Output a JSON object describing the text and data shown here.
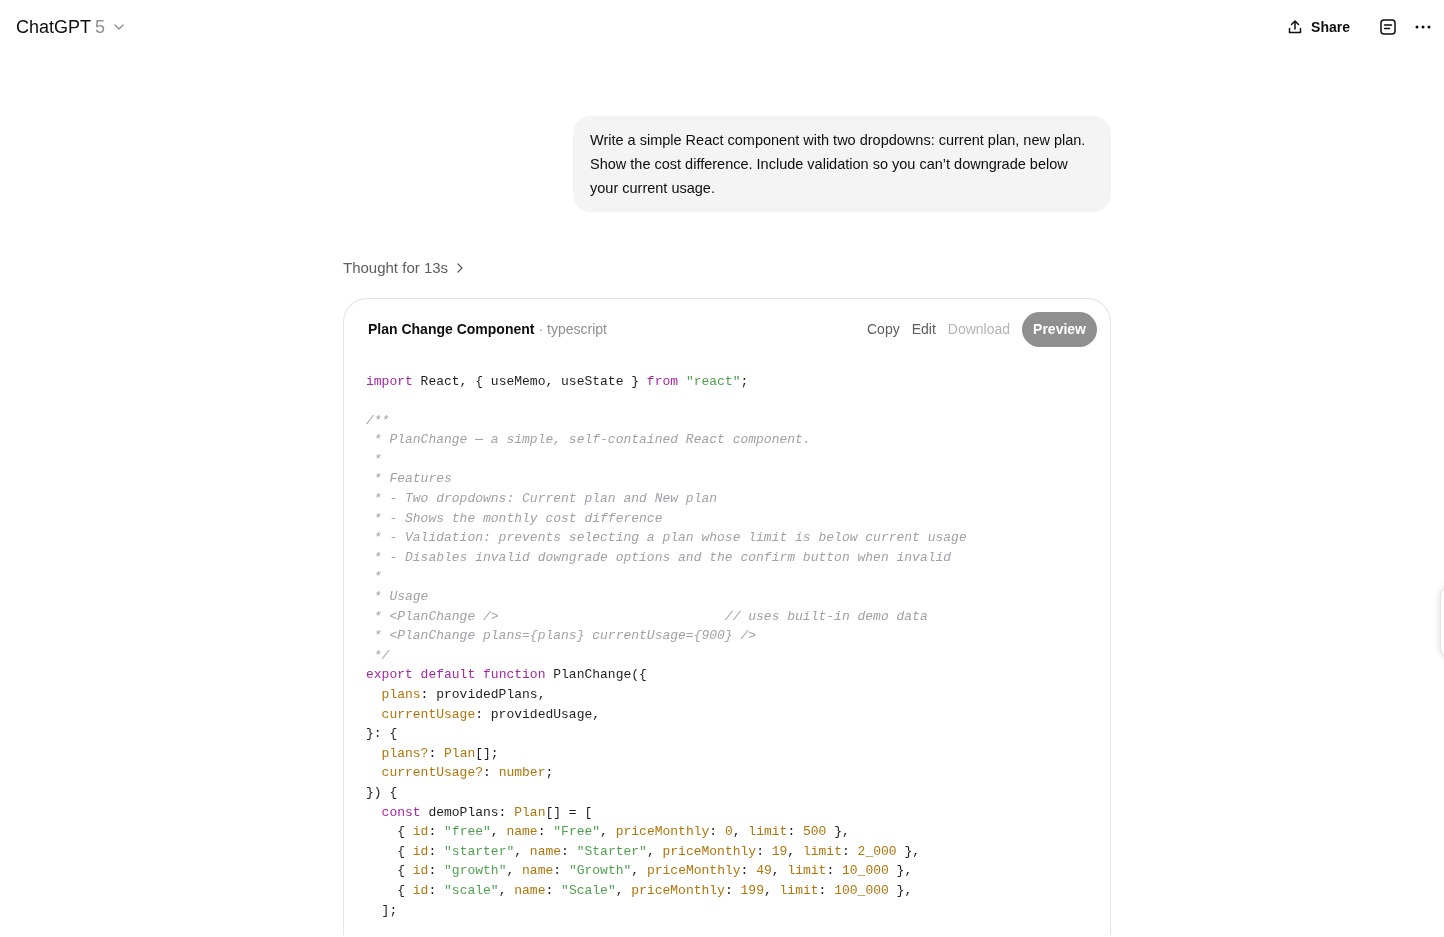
{
  "header": {
    "model_name": "ChatGPT",
    "model_version": "5",
    "share_label": "Share"
  },
  "user_message": "Write a simple React component with two dropdowns: current plan, new plan. Show the cost difference. Include validation so you can’t downgrade below your current usage.",
  "thought_label": "Thought for 13s",
  "code_card": {
    "title": "Plan Change Component",
    "language": "· typescript",
    "actions": [
      {
        "label": "Copy",
        "disabled": false
      },
      {
        "label": "Edit",
        "disabled": false
      },
      {
        "label": "Download",
        "disabled": true
      }
    ],
    "preview_label": "Preview",
    "lines": [
      {
        "kind": "code",
        "tokens": [
          {
            "kind": "kw",
            "text": "import"
          },
          {
            "kind": "pl",
            "text": " React, { useMemo, useState } "
          },
          {
            "kind": "kw",
            "text": "from"
          },
          {
            "kind": "str",
            "text": " \"react\""
          },
          {
            "kind": "pl",
            "text": ";"
          }
        ]
      },
      {
        "kind": "blank"
      },
      {
        "kind": "code",
        "tokens": [
          {
            "kind": "cm",
            "text": "/**"
          }
        ]
      },
      {
        "kind": "code",
        "tokens": [
          {
            "kind": "cm",
            "text": " * PlanChange — a simple, self-contained React component."
          }
        ]
      },
      {
        "kind": "code",
        "tokens": [
          {
            "kind": "cm",
            "text": " *"
          }
        ]
      },
      {
        "kind": "code",
        "tokens": [
          {
            "kind": "cm",
            "text": " * Features"
          }
        ]
      },
      {
        "kind": "code",
        "tokens": [
          {
            "kind": "cm",
            "text": " * - Two dropdowns: Current plan and New plan"
          }
        ]
      },
      {
        "kind": "code",
        "tokens": [
          {
            "kind": "cm",
            "text": " * - Shows the monthly cost difference"
          }
        ]
      },
      {
        "kind": "code",
        "tokens": [
          {
            "kind": "cm",
            "text": " * - Validation: prevents selecting a plan whose limit is below current usage"
          }
        ]
      },
      {
        "kind": "code",
        "tokens": [
          {
            "kind": "cm",
            "text": " * - Disables invalid downgrade options and the confirm button when invalid"
          }
        ]
      },
      {
        "kind": "code",
        "tokens": [
          {
            "kind": "cm",
            "text": " *"
          }
        ]
      },
      {
        "kind": "code",
        "tokens": [
          {
            "kind": "cm",
            "text": " * Usage"
          }
        ]
      },
      {
        "kind": "code",
        "tokens": [
          {
            "kind": "cm",
            "text": " * <PlanChange />                             // uses built-in demo data"
          }
        ]
      },
      {
        "kind": "code",
        "tokens": [
          {
            "kind": "cm",
            "text": " * <PlanChange plans={plans} currentUsage={900} />"
          }
        ]
      },
      {
        "kind": "code",
        "tokens": [
          {
            "kind": "cm",
            "text": " */"
          }
        ]
      },
      {
        "kind": "code",
        "tokens": [
          {
            "kind": "kw",
            "text": "export"
          },
          {
            "kind": "kw",
            "text": " default"
          },
          {
            "kind": "kw",
            "text": " function"
          },
          {
            "kind": "pl",
            "text": " PlanChange({"
          }
        ]
      },
      {
        "kind": "code",
        "tokens": [
          {
            "kind": "prop",
            "text": "  plans"
          },
          {
            "kind": "pl",
            "text": ": providedPlans,"
          }
        ]
      },
      {
        "kind": "code",
        "tokens": [
          {
            "kind": "prop",
            "text": "  currentUsage"
          },
          {
            "kind": "pl",
            "text": ": providedUsage,"
          }
        ]
      },
      {
        "kind": "code",
        "tokens": [
          {
            "kind": "pl",
            "text": "}: {"
          }
        ]
      },
      {
        "kind": "code",
        "tokens": [
          {
            "kind": "prop",
            "text": "  plans?"
          },
          {
            "kind": "pl",
            "text": ": "
          },
          {
            "kind": "prop",
            "text": "Plan"
          },
          {
            "kind": "pl",
            "text": "[];"
          }
        ]
      },
      {
        "kind": "code",
        "tokens": [
          {
            "kind": "prop",
            "text": "  currentUsage?"
          },
          {
            "kind": "pl",
            "text": ": "
          },
          {
            "kind": "prop",
            "text": "number"
          },
          {
            "kind": "pl",
            "text": ";"
          }
        ]
      },
      {
        "kind": "code",
        "tokens": [
          {
            "kind": "pl",
            "text": "}) {"
          }
        ]
      },
      {
        "kind": "code",
        "tokens": [
          {
            "kind": "kw",
            "text": "  const"
          },
          {
            "kind": "pl",
            "text": " demoPlans: "
          },
          {
            "kind": "prop",
            "text": "Plan"
          },
          {
            "kind": "pl",
            "text": "[] = ["
          }
        ]
      },
      {
        "kind": "code",
        "tokens": [
          {
            "kind": "pl",
            "text": "    { "
          },
          {
            "kind": "prop",
            "text": "id"
          },
          {
            "kind": "pl",
            "text": ": "
          },
          {
            "kind": "str",
            "text": "\"free\""
          },
          {
            "kind": "pl",
            "text": ", "
          },
          {
            "kind": "prop",
            "text": "name"
          },
          {
            "kind": "pl",
            "text": ": "
          },
          {
            "kind": "str",
            "text": "\"Free\""
          },
          {
            "kind": "pl",
            "text": ", "
          },
          {
            "kind": "prop",
            "text": "priceMonthly"
          },
          {
            "kind": "pl",
            "text": ": "
          },
          {
            "kind": "num",
            "text": "0"
          },
          {
            "kind": "pl",
            "text": ", "
          },
          {
            "kind": "prop",
            "text": "limit"
          },
          {
            "kind": "pl",
            "text": ": "
          },
          {
            "kind": "num",
            "text": "500"
          },
          {
            "kind": "pl",
            "text": " },"
          }
        ]
      },
      {
        "kind": "code",
        "tokens": [
          {
            "kind": "pl",
            "text": "    { "
          },
          {
            "kind": "prop",
            "text": "id"
          },
          {
            "kind": "pl",
            "text": ": "
          },
          {
            "kind": "str",
            "text": "\"starter\""
          },
          {
            "kind": "pl",
            "text": ", "
          },
          {
            "kind": "prop",
            "text": "name"
          },
          {
            "kind": "pl",
            "text": ": "
          },
          {
            "kind": "str",
            "text": "\"Starter\""
          },
          {
            "kind": "pl",
            "text": ", "
          },
          {
            "kind": "prop",
            "text": "priceMonthly"
          },
          {
            "kind": "pl",
            "text": ": "
          },
          {
            "kind": "num",
            "text": "19"
          },
          {
            "kind": "pl",
            "text": ", "
          },
          {
            "kind": "prop",
            "text": "limit"
          },
          {
            "kind": "pl",
            "text": ": "
          },
          {
            "kind": "num",
            "text": "2_000"
          },
          {
            "kind": "pl",
            "text": " },"
          }
        ]
      },
      {
        "kind": "code",
        "tokens": [
          {
            "kind": "pl",
            "text": "    { "
          },
          {
            "kind": "prop",
            "text": "id"
          },
          {
            "kind": "pl",
            "text": ": "
          },
          {
            "kind": "str",
            "text": "\"growth\""
          },
          {
            "kind": "pl",
            "text": ", "
          },
          {
            "kind": "prop",
            "text": "name"
          },
          {
            "kind": "pl",
            "text": ": "
          },
          {
            "kind": "str",
            "text": "\"Growth\""
          },
          {
            "kind": "pl",
            "text": ", "
          },
          {
            "kind": "prop",
            "text": "priceMonthly"
          },
          {
            "kind": "pl",
            "text": ": "
          },
          {
            "kind": "num",
            "text": "49"
          },
          {
            "kind": "pl",
            "text": ", "
          },
          {
            "kind": "prop",
            "text": "limit"
          },
          {
            "kind": "pl",
            "text": ": "
          },
          {
            "kind": "num",
            "text": "10_000"
          },
          {
            "kind": "pl",
            "text": " },"
          }
        ]
      },
      {
        "kind": "code",
        "tokens": [
          {
            "kind": "pl",
            "text": "    { "
          },
          {
            "kind": "prop",
            "text": "id"
          },
          {
            "kind": "pl",
            "text": ": "
          },
          {
            "kind": "str",
            "text": "\"scale\""
          },
          {
            "kind": "pl",
            "text": ", "
          },
          {
            "kind": "prop",
            "text": "name"
          },
          {
            "kind": "pl",
            "text": ": "
          },
          {
            "kind": "str",
            "text": "\"Scale\""
          },
          {
            "kind": "pl",
            "text": ", "
          },
          {
            "kind": "prop",
            "text": "priceMonthly"
          },
          {
            "kind": "pl",
            "text": ": "
          },
          {
            "kind": "num",
            "text": "199"
          },
          {
            "kind": "pl",
            "text": ", "
          },
          {
            "kind": "prop",
            "text": "limit"
          },
          {
            "kind": "pl",
            "text": ": "
          },
          {
            "kind": "num",
            "text": "100_000"
          },
          {
            "kind": "pl",
            "text": " },"
          }
        ]
      },
      {
        "kind": "code",
        "tokens": [
          {
            "kind": "pl",
            "text": "  ];"
          }
        ]
      }
    ]
  }
}
